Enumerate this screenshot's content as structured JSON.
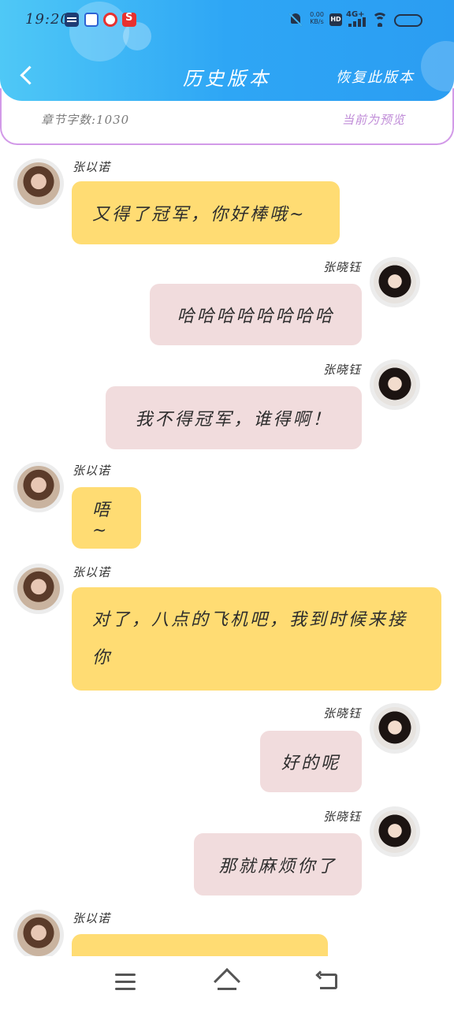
{
  "status_bar": {
    "time": "19:20",
    "net_speed_value": "0.00",
    "net_speed_unit": "KB/s",
    "hd_label": "HD",
    "network_label": "4G+",
    "icons": [
      "calendar-icon",
      "baidu-icon",
      "weibo-icon",
      "red-app-icon",
      "mute-icon",
      "hd-icon",
      "signal-icon",
      "wifi-icon",
      "battery-icon"
    ]
  },
  "header": {
    "title": "历史版本",
    "restore_label": "恢复此版本",
    "back_icon": "chevron-left-icon"
  },
  "info": {
    "chapter_word_count": "章节字数:1030",
    "preview_label": "当前为预览"
  },
  "colors": {
    "header_gradient_start": "#4fc8f6",
    "header_gradient_end": "#2b9df2",
    "info_border": "#d29ae8",
    "preview_text": "#c08cd8",
    "bubble_left": "#ffdc73",
    "bubble_right": "#f1dcdd"
  },
  "messages": [
    {
      "side": "left",
      "sender": "张以诺",
      "text": "又得了冠军，你好棒哦~"
    },
    {
      "side": "right",
      "sender": "张晓钰",
      "text": "哈哈哈哈哈哈哈哈"
    },
    {
      "side": "right",
      "sender": "张晓钰",
      "text": "我不得冠军，谁得啊！"
    },
    {
      "side": "left",
      "sender": "张以诺",
      "text": "唔~"
    },
    {
      "side": "left",
      "sender": "张以诺",
      "text": "对了，八点的飞机吧，我到时候来接你"
    },
    {
      "side": "right",
      "sender": "张晓钰",
      "text": "好的呢"
    },
    {
      "side": "right",
      "sender": "张晓钰",
      "text": "那就麻烦你了"
    },
    {
      "side": "left",
      "sender": "张以诺",
      "text": ""
    }
  ],
  "bottom_nav": {
    "icons": [
      "menu-icon",
      "home-icon",
      "back-icon"
    ]
  }
}
